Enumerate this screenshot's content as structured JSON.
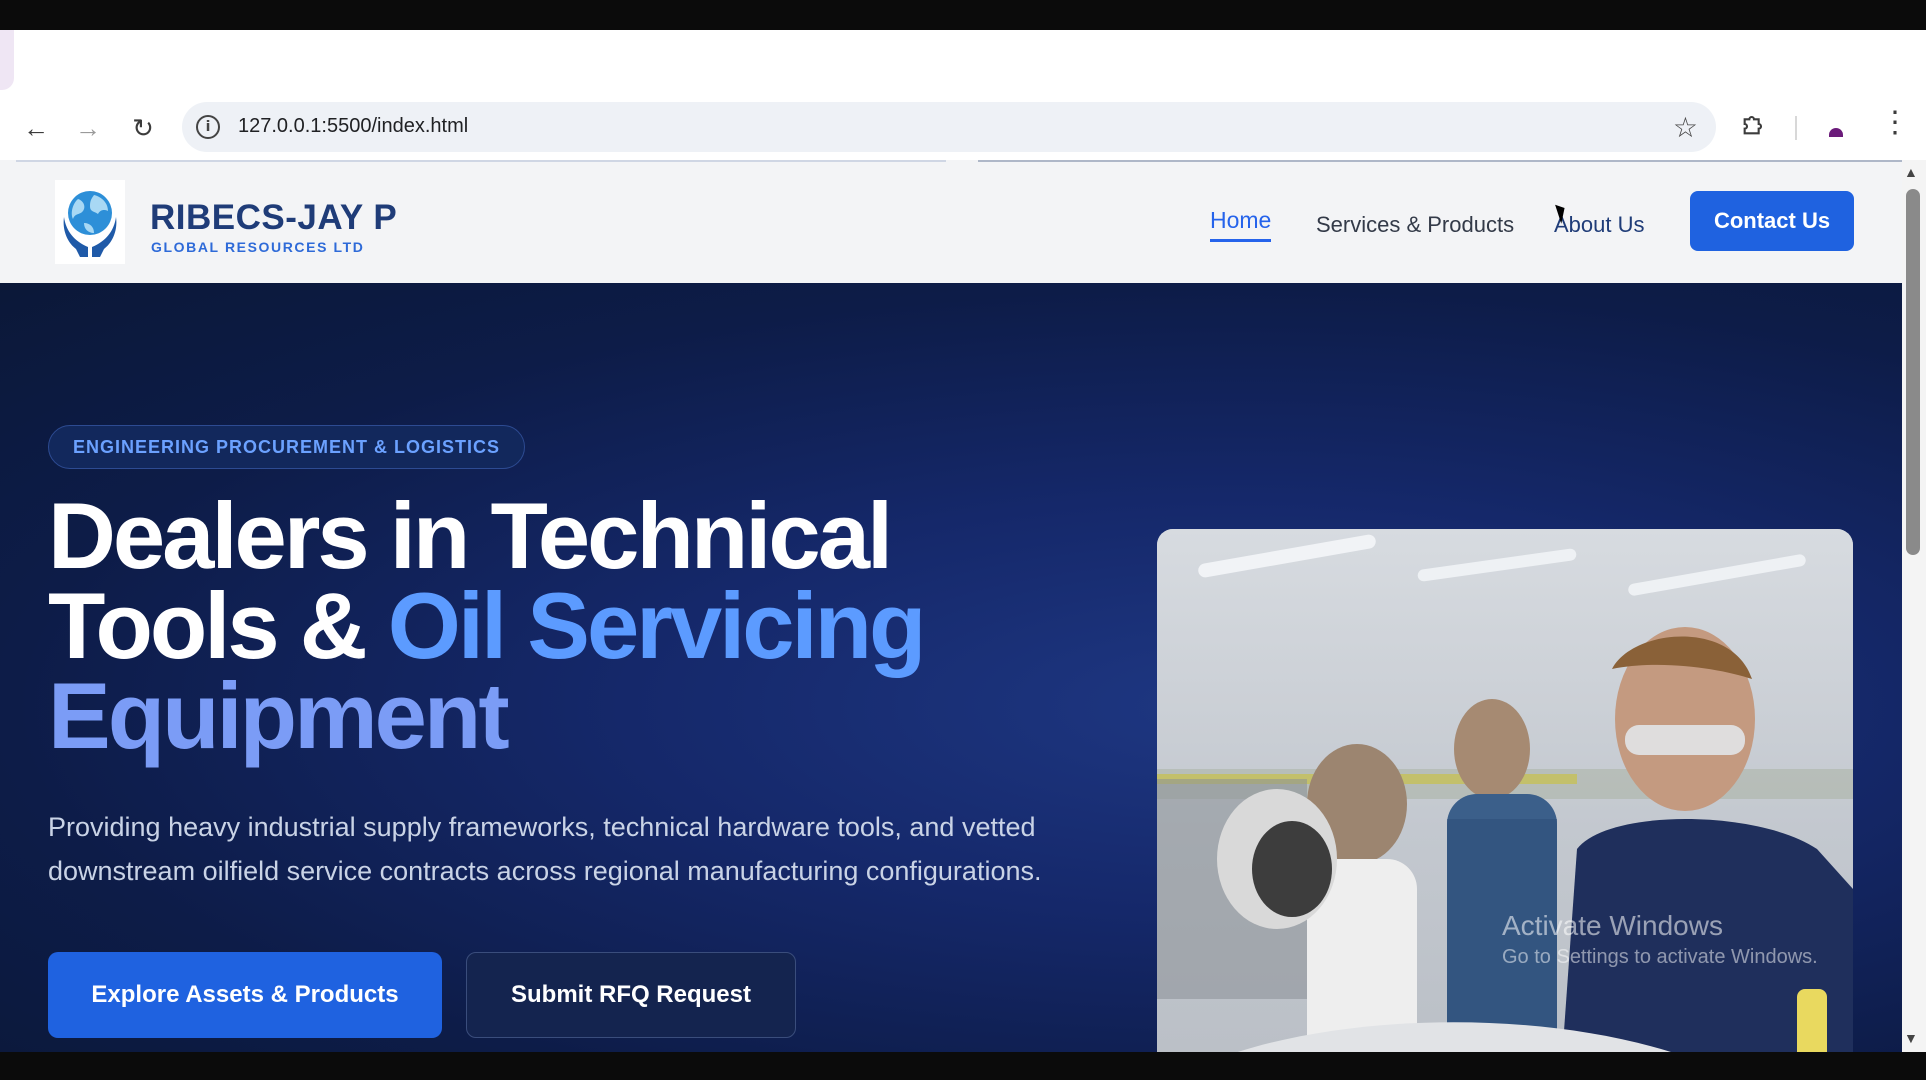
{
  "browser": {
    "url": "127.0.0.1:5500/index.html",
    "icons": {
      "back": "arrow-left-icon",
      "forward": "arrow-right-icon",
      "reload": "reload-icon",
      "site_info": "info-icon",
      "bookmark": "star-icon",
      "extensions": "puzzle-icon",
      "profile": "profile-icon",
      "menu": "kebab-menu-icon"
    }
  },
  "site": {
    "brand": {
      "name": "RIBECS-JAY P",
      "subtitle": "GLOBAL RESOURCES LTD"
    },
    "nav": {
      "home": "Home",
      "services": "Services & Products",
      "about": "About Us",
      "contact": "Contact Us"
    },
    "hero": {
      "eyebrow": "ENGINEERING PROCUREMENT & LOGISTICS",
      "headline_part1": "Dealers in Technical",
      "headline_part2": "Tools & ",
      "headline_highlight1": "Oil Servicing",
      "headline_highlight2": "Equipment",
      "lede": "Providing heavy industrial supply frameworks, technical hardware tools, and vetted downstream oilfield service contracts across regional manufacturing configurations.",
      "primary_cta": "Explore Assets & Products",
      "secondary_cta": "Submit RFQ Request"
    }
  },
  "os": {
    "watermark_title": "Activate Windows",
    "watermark_sub": "Go to Settings to activate Windows."
  },
  "colors": {
    "brand_navy": "#1f3c78",
    "accent_blue": "#1f62e0",
    "highlight_blue": "#5c9bff",
    "hero_bg": "#15286a"
  }
}
